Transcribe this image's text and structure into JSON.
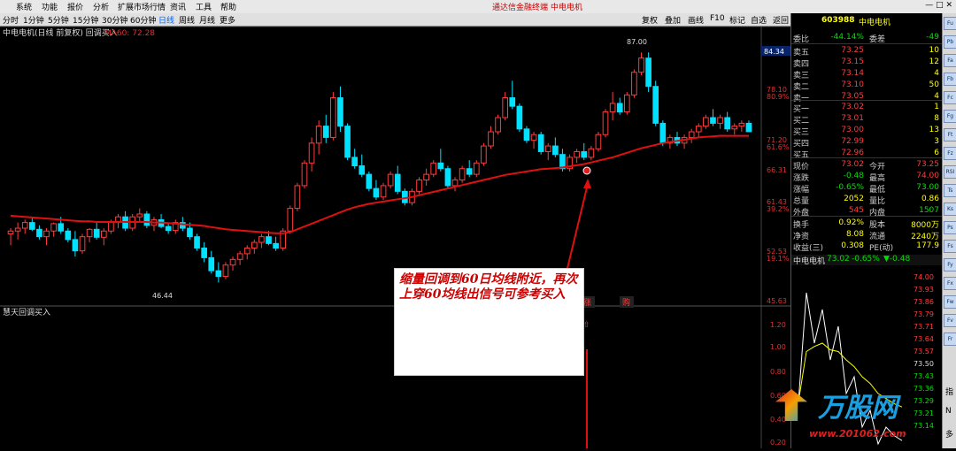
{
  "menu": {
    "items": [
      "系统",
      "功能",
      "报价",
      "分析",
      "扩展市场行情",
      "资讯",
      "工具",
      "帮助"
    ],
    "brand": "通达信金融终端",
    "stock_name_title": "中电电机"
  },
  "tabs": {
    "items": [
      "分时",
      "1分钟",
      "5分钟",
      "15分钟",
      "30分钟",
      "60分钟",
      "日线",
      "周线",
      "月线",
      "更多"
    ],
    "active": "日线",
    "toolbar": [
      "复权",
      "叠加",
      "画线",
      "F10",
      "标记",
      "自选",
      "返回"
    ]
  },
  "main_chart": {
    "title": "中电电机(日线 前复权) 回调买入",
    "indicator": "MA60: 72.28",
    "price_labels": [
      "84.34",
      "78.10",
      "80.9%",
      "71.20",
      "61.6%",
      "66.31",
      "61.43",
      "39.2%",
      "52.53",
      "19.1%",
      "45.63"
    ],
    "high_label": "87.00",
    "low_label": "46.44",
    "sub_title": "慧天回调买入",
    "sub_axis": [
      "1.20",
      "1.00",
      "0.80",
      "0.60",
      "0.40",
      "0.20"
    ],
    "signal_up": "涨",
    "signal_buy": "购"
  },
  "callout": {
    "text": "缩量回调到60日均线附近，再次上穿60均线出信号可参考买入"
  },
  "quote": {
    "code": "603988",
    "name": "中电电机",
    "webi_label": "委比",
    "webi_value": "-44.14%",
    "weicha_label": "委差",
    "weicha_value": "-49",
    "sell": [
      {
        "label": "卖五",
        "price": "73.25",
        "vol": "10"
      },
      {
        "label": "卖四",
        "price": "73.15",
        "vol": "12"
      },
      {
        "label": "卖三",
        "price": "73.14",
        "vol": "4"
      },
      {
        "label": "卖二",
        "price": "73.10",
        "vol": "50"
      },
      {
        "label": "卖一",
        "price": "73.05",
        "vol": "4"
      }
    ],
    "buy": [
      {
        "label": "买一",
        "price": "73.02",
        "vol": "1"
      },
      {
        "label": "买二",
        "price": "73.01",
        "vol": "8"
      },
      {
        "label": "买三",
        "price": "73.00",
        "vol": "13"
      },
      {
        "label": "买四",
        "price": "72.99",
        "vol": "3"
      },
      {
        "label": "买五",
        "price": "72.96",
        "vol": "6"
      }
    ],
    "stats": [
      {
        "l1": "现价",
        "v1": "73.02",
        "c1": "red",
        "l2": "今开",
        "v2": "73.25",
        "c2": "red"
      },
      {
        "l1": "涨跌",
        "v1": "-0.48",
        "c1": "green",
        "l2": "最高",
        "v2": "74.00",
        "c2": "red"
      },
      {
        "l1": "涨幅",
        "v1": "-0.65%",
        "c1": "green",
        "l2": "最低",
        "v2": "73.00",
        "c2": "green"
      },
      {
        "l1": "总量",
        "v1": "2052",
        "c1": "yellow",
        "l2": "量比",
        "v2": "0.86",
        "c2": "yellow"
      },
      {
        "l1": "外盘",
        "v1": "545",
        "c1": "red",
        "l2": "内盘",
        "v2": "1507",
        "c2": "green"
      }
    ],
    "stats2": [
      {
        "l1": "换手",
        "v1": "0.92%",
        "l2": "股本",
        "v2": "8000万"
      },
      {
        "l1": "净资",
        "v1": "8.08",
        "l2": "流通",
        "v2": "2240万"
      },
      {
        "l1": "收益(三)",
        "v1": "0.308",
        "l2": "PE(动)",
        "v2": "177.9"
      }
    ],
    "mini_title": "中电电机",
    "mini_price": "73.02",
    "mini_pct": "-0.65%",
    "mini_chg": "▼-0.48",
    "mini_axis": [
      "74.00",
      "73.93",
      "73.86",
      "73.79",
      "73.71",
      "73.64",
      "73.57",
      "73.50",
      "73.43",
      "73.36",
      "73.29",
      "73.21",
      "73.14"
    ]
  },
  "sidebar": {
    "items": [
      "Fu",
      "Pb",
      "Fa",
      "Fb",
      "Fc",
      "Fg",
      "Ft",
      "Fz",
      "RSI",
      "Ts",
      "Ks",
      "Ps",
      "Fs",
      "Fy",
      "Fx",
      "Fw",
      "Fv",
      "Fr"
    ],
    "bottom": [
      "指",
      "N",
      "多"
    ]
  },
  "watermark": {
    "text": "万股网",
    "url": "www.201062.com"
  },
  "colors": {
    "up": "#ff3c3c",
    "down": "#00e0ff",
    "ma": "#e01010",
    "bg": "#000000"
  },
  "chart_data": {
    "type": "candlestick",
    "title": "中电电机(日线 前复权) 回调买入",
    "ylim": [
      44,
      90
    ],
    "candles": [
      [
        55,
        56,
        53,
        55.5
      ],
      [
        55.5,
        57,
        54,
        56
      ],
      [
        56,
        57.5,
        55,
        57
      ],
      [
        57,
        58,
        55.5,
        55.8
      ],
      [
        55.8,
        56.5,
        54,
        54.5
      ],
      [
        54.5,
        56,
        53,
        55.5
      ],
      [
        55.5,
        57,
        54.5,
        56.8
      ],
      [
        56.8,
        58,
        55,
        55.5
      ],
      [
        55.5,
        56,
        53.5,
        54
      ],
      [
        54,
        55.5,
        51,
        52
      ],
      [
        52,
        55,
        51.5,
        54.5
      ],
      [
        54.5,
        56,
        53.5,
        55.8
      ],
      [
        55.8,
        57,
        54,
        54.4
      ],
      [
        54.4,
        56,
        53,
        55.5
      ],
      [
        55.5,
        57.5,
        55,
        57
      ],
      [
        57,
        58.5,
        56,
        58
      ],
      [
        58,
        59,
        55.5,
        56
      ],
      [
        56,
        58.5,
        55.5,
        58
      ],
      [
        58,
        59.5,
        57,
        58.5
      ],
      [
        58.5,
        59,
        56,
        56.5
      ],
      [
        56.5,
        58,
        55.5,
        57.5
      ],
      [
        57.5,
        58.5,
        56,
        56.3
      ],
      [
        56.3,
        57,
        55,
        55.6
      ],
      [
        55.6,
        57.5,
        55,
        57
      ],
      [
        57,
        58,
        55.5,
        56
      ],
      [
        56,
        57,
        54,
        54.5
      ],
      [
        54.5,
        55,
        52,
        52.5
      ],
      [
        52.5,
        53.5,
        50,
        50.8
      ],
      [
        50.8,
        52,
        48,
        48.5
      ],
      [
        48.5,
        50,
        46.44,
        47.5
      ],
      [
        47.5,
        50,
        47,
        49.5
      ],
      [
        49.5,
        51,
        48.5,
        50.5
      ],
      [
        50.5,
        52,
        49.5,
        51.5
      ],
      [
        51.5,
        53,
        50.5,
        52.5
      ],
      [
        52.5,
        54,
        51.5,
        53.5
      ],
      [
        53.5,
        55,
        52.5,
        54.5
      ],
      [
        54.5,
        55.5,
        53,
        53.3
      ],
      [
        53.3,
        54.5,
        52,
        52.5
      ],
      [
        52.5,
        56,
        52,
        55.5
      ],
      [
        55.5,
        60,
        55,
        59.5
      ],
      [
        59.5,
        64,
        59,
        63.5
      ],
      [
        63.5,
        68,
        63,
        67.5
      ],
      [
        67.5,
        72,
        66,
        71
      ],
      [
        71,
        75,
        69,
        74
      ],
      [
        74,
        76,
        71,
        72
      ],
      [
        72,
        80,
        71.5,
        79
      ],
      [
        79,
        81,
        73,
        74
      ],
      [
        74,
        74.5,
        68,
        68.5
      ],
      [
        68.5,
        70,
        66.5,
        67
      ],
      [
        67,
        69,
        65,
        65.5
      ],
      [
        65.5,
        66,
        62.5,
        63
      ],
      [
        63,
        64.5,
        61,
        61.5
      ],
      [
        61.5,
        64,
        61,
        63.5
      ],
      [
        63.5,
        66,
        63,
        65.5
      ],
      [
        65.5,
        67,
        62,
        62.5
      ],
      [
        62.5,
        63,
        60,
        60.5
      ],
      [
        60.5,
        63,
        60,
        62.5
      ],
      [
        62.5,
        65,
        62,
        64.5
      ],
      [
        64.5,
        66.5,
        63.5,
        65.5
      ],
      [
        65.5,
        68,
        65,
        67.5
      ],
      [
        67.5,
        70,
        66,
        66.5
      ],
      [
        66.5,
        67,
        63,
        63.5
      ],
      [
        63.5,
        65,
        62.5,
        64.5
      ],
      [
        64.5,
        67,
        64,
        66.5
      ],
      [
        66.5,
        68,
        65,
        65.5
      ],
      [
        65.5,
        68,
        65,
        67.5
      ],
      [
        67.5,
        71,
        67,
        70.5
      ],
      [
        70.5,
        74,
        70,
        73
      ],
      [
        73,
        76,
        72.5,
        75.5
      ],
      [
        75.5,
        80,
        75,
        79
      ],
      [
        79,
        82,
        77,
        77.5
      ],
      [
        77.5,
        78,
        73,
        73.5
      ],
      [
        73.5,
        74,
        71,
        71.5
      ],
      [
        71.5,
        73,
        70,
        72.5
      ],
      [
        72.5,
        73,
        69,
        69.5
      ],
      [
        69.5,
        71,
        68,
        70.5
      ],
      [
        70.5,
        72,
        68.5,
        69
      ],
      [
        69,
        70,
        66,
        66.5
      ],
      [
        66.5,
        69,
        66,
        68.5
      ],
      [
        68.5,
        70,
        67.5,
        69.5
      ],
      [
        69.5,
        71,
        68,
        68.5
      ],
      [
        68.5,
        70.5,
        68,
        70
      ],
      [
        70,
        73,
        69.5,
        72.5
      ],
      [
        72.5,
        77,
        72,
        76.5
      ],
      [
        76.5,
        80,
        75,
        78
      ],
      [
        78,
        79,
        76,
        76.5
      ],
      [
        76.5,
        80,
        76,
        79.5
      ],
      [
        79.5,
        84,
        79,
        83.5
      ],
      [
        83.5,
        87,
        83,
        86
      ],
      [
        86,
        87,
        80,
        81
      ],
      [
        81,
        82,
        74,
        74.5
      ],
      [
        74.5,
        75,
        70.5,
        71
      ],
      [
        71,
        72.5,
        70,
        72
      ],
      [
        72,
        73,
        70.5,
        71
      ],
      [
        71,
        72.5,
        70,
        72
      ],
      [
        72,
        73.5,
        71,
        73
      ],
      [
        73,
        74.5,
        72,
        74
      ],
      [
        74,
        76,
        73.5,
        75.5
      ],
      [
        75.5,
        77,
        74,
        74.5
      ],
      [
        74.5,
        76,
        73.5,
        75.5
      ],
      [
        75.5,
        76.5,
        73,
        73.5
      ],
      [
        73.5,
        74.5,
        72.5,
        74
      ],
      [
        74,
        75,
        73,
        74.5
      ],
      [
        74.5,
        75,
        73,
        73.02
      ]
    ],
    "ma60": [
      58.2,
      58.1,
      58.0,
      57.9,
      57.8,
      57.7,
      57.6,
      57.5,
      57.4,
      57.3,
      57.2,
      57.2,
      57.1,
      57.1,
      57.1,
      57.1,
      57.1,
      57.1,
      57.1,
      57.1,
      57.0,
      57.0,
      56.9,
      56.8,
      56.7,
      56.6,
      56.5,
      56.4,
      56.2,
      56.0,
      55.8,
      55.7,
      55.6,
      55.5,
      55.4,
      55.3,
      55.2,
      55.1,
      55.1,
      55.3,
      55.8,
      56.3,
      56.8,
      57.3,
      57.8,
      58.3,
      58.8,
      59.3,
      59.7,
      60.0,
      60.3,
      60.5,
      60.7,
      60.9,
      61.1,
      61.3,
      61.5,
      61.8,
      62.1,
      62.4,
      62.7,
      63.0,
      63.3,
      63.6,
      63.9,
      64.2,
      64.5,
      64.8,
      65.1,
      65.4,
      65.6,
      65.8,
      66.0,
      66.2,
      66.4,
      66.5,
      66.6,
      66.7,
      66.9,
      67.1,
      67.3,
      67.6,
      67.9,
      68.2,
      68.5,
      68.9,
      69.3,
      69.7,
      70.1,
      70.4,
      70.7,
      71.0,
      71.2,
      71.4,
      71.6,
      71.8,
      72.0,
      72.1,
      72.2,
      72.3,
      72.28,
      72.28,
      72.28,
      72.28
    ]
  }
}
